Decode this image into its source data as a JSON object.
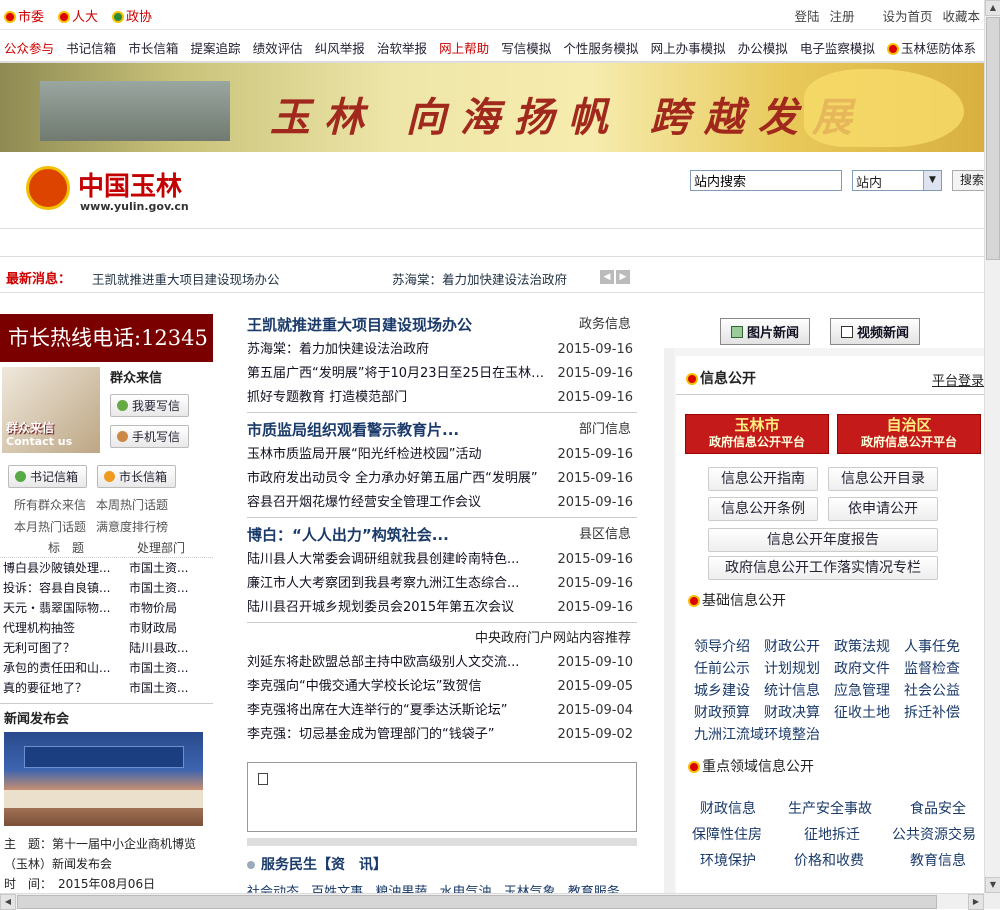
{
  "topbar": {
    "left": [
      "市委",
      "人大",
      "政协"
    ],
    "right": [
      "登陆",
      "注册",
      "设为首页",
      "收藏本"
    ]
  },
  "nav": [
    {
      "label": "公众参与",
      "red": true
    },
    {
      "label": "书记信箱"
    },
    {
      "label": "市长信箱"
    },
    {
      "label": "提案追踪"
    },
    {
      "label": "绩效评估"
    },
    {
      "label": "纠风举报"
    },
    {
      "label": "治软举报"
    },
    {
      "label": "网上帮助",
      "red": true
    },
    {
      "label": "写信模拟"
    },
    {
      "label": "个性服务模拟"
    },
    {
      "label": "网上办事模拟"
    },
    {
      "label": "办公模拟"
    },
    {
      "label": "电子监察模拟"
    },
    {
      "label": "玉林惩防体系"
    }
  ],
  "banner": {
    "slogan": "玉林 向海扬帆 跨越发展"
  },
  "logo": {
    "name": "中国玉林",
    "url": "www.yulin.gov.cn"
  },
  "search": {
    "value": "站内搜索",
    "scope": "站内",
    "button": "搜索"
  },
  "ticker": {
    "label": "最新消息：",
    "items": [
      "王凯就推进重大项目建设现场办公",
      "苏海棠：着力加快建设法治政府"
    ]
  },
  "left": {
    "hotline": "市长热线电话:12345",
    "mail": {
      "title": "群众来信",
      "img_title": "群众来信",
      "img_sub": "Contact us",
      "write": "我要写信",
      "mobile": "手机写信"
    },
    "boxes": [
      "书记信箱",
      "市长信箱"
    ],
    "links": [
      "所有群众来信",
      "本周热门话题",
      "本月热门话题",
      "满意度排行榜"
    ],
    "table_header": [
      "标　题",
      "处理部门"
    ],
    "table": [
      [
        "博白县沙陂镇处理...",
        "市国土资..."
      ],
      [
        "投诉：容县自良镇...",
        "市国土资..."
      ],
      [
        "天元・翡翠国际物...",
        "市物价局"
      ],
      [
        "代理机构抽签",
        "市财政局"
      ],
      [
        "无利可图了？",
        "陆川县政..."
      ],
      [
        "承包的责任田和山...",
        "市国土资..."
      ],
      [
        "真的要征地了？",
        "市国土资..."
      ]
    ],
    "press_title": "新闻发布会",
    "press_caption": [
      "主　题：第十一届中小企业商机博览（玉林）新闻发布会",
      "时　间：　2015年08月06日"
    ]
  },
  "middle": {
    "sections": [
      {
        "headline": "王凯就推进重大项目建设现场办公",
        "tag": "政务信息",
        "items": [
          {
            "text": "苏海棠：着力加快建设法治政府",
            "date": "2015-09-16"
          },
          {
            "text": "第五届广西“发明展”将于10月23日至25日在玉林举办",
            "date": "2015-09-16"
          },
          {
            "text": "抓好专题教育 打造模范部门",
            "date": "2015-09-16"
          }
        ]
      },
      {
        "headline": "市质监局组织观看警示教育片...",
        "tag": "部门信息",
        "items": [
          {
            "text": "玉林市质监局开展“阳光纤检进校园”活动",
            "date": "2015-09-16"
          },
          {
            "text": "市政府发出动员令 全力承办好第五届广西“发明展”",
            "date": "2015-09-16"
          },
          {
            "text": "容县召开烟花爆竹经营安全管理工作会议",
            "date": "2015-09-16"
          }
        ]
      },
      {
        "headline": "博白：“人人出力”构筑社会...",
        "tag": "县区信息",
        "items": [
          {
            "text": "陆川县人大常委会调研组就我县创建岭南特色...",
            "date": "2015-09-16"
          },
          {
            "text": "廉江市人大考察团到我县考察九洲江生态综合...",
            "date": "2015-09-16"
          },
          {
            "text": "陆川县召开城乡规划委员会2015年第五次会议",
            "date": "2015-09-16"
          }
        ]
      }
    ],
    "central_title": "中央政府门户网站内容推荐",
    "central_items": [
      {
        "text": "刘延东将赴欧盟总部主持中欧高级别人文交流...",
        "date": "2015-09-10"
      },
      {
        "text": "李克强向“中俄交通大学校长论坛”致贺信",
        "date": "2015-09-05"
      },
      {
        "text": "李克强将出席在大连举行的“夏季达沃斯论坛”",
        "date": "2015-09-04"
      },
      {
        "text": "李克强：切忌基金成为管理部门的“钱袋子”",
        "date": "2015-09-02"
      }
    ],
    "service_title": "服务民生【资　讯】",
    "service_links": [
      "社会动态",
      "百姓文事",
      "粮油果蔬",
      "水电气油",
      "玉林气象",
      "教育服务"
    ]
  },
  "right": {
    "tabs": [
      "图片新闻",
      "视频新闻"
    ],
    "title": "信息公开",
    "login": "平台登录",
    "platforms": [
      {
        "a": "玉林市",
        "b": "政府信息公开平台"
      },
      {
        "a": "自治区",
        "b": "政府信息公开平台"
      }
    ],
    "buttons": [
      "信息公开指南",
      "信息公开目录",
      "信息公开条例",
      "依申请公开"
    ],
    "wide_buttons": [
      "信息公开年度报告",
      "政府信息公开工作落实情况专栏"
    ],
    "basic_title": "基础信息公开",
    "basic_links": [
      "领导介绍",
      "财政公开",
      "政策法规",
      "人事任免",
      "任前公示",
      "计划规划",
      "政府文件",
      "监督检查",
      "城乡建设",
      "统计信息",
      "应急管理",
      "社会公益",
      "财政预算",
      "财政决算",
      "征收土地",
      "拆迁补偿",
      "九洲江流域环境整治"
    ],
    "key_title": "重点领域信息公开",
    "key_links": [
      "财政信息",
      "生产安全事故",
      "食品安全",
      "保障性住房",
      "征地拆迁",
      "公共资源交易",
      "环境保护",
      "价格和收费",
      "教育信息"
    ]
  }
}
